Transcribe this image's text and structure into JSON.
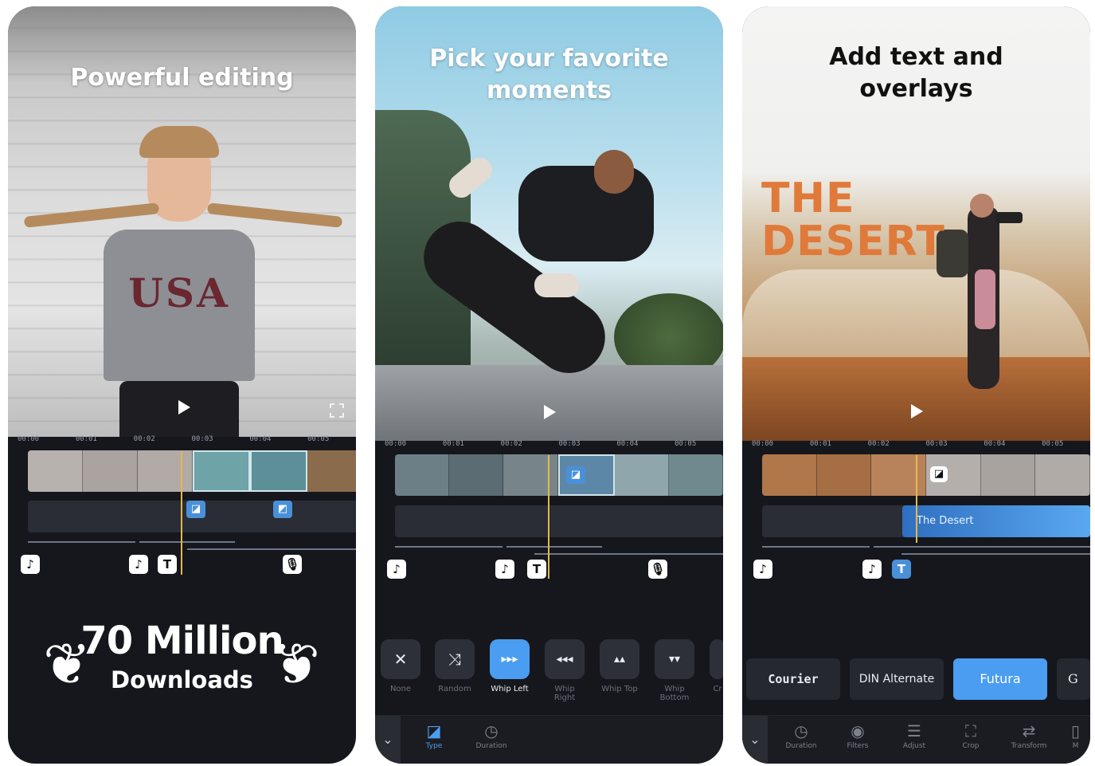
{
  "screens": [
    {
      "headline": "Powerful editing",
      "timecodes": [
        "00:00",
        "00:01",
        "00:02",
        "00:03",
        "00:04",
        "00:05"
      ],
      "badge_music": "♪",
      "badge_text": "T",
      "mic_icon": "mic-icon",
      "downloads_number": "70 Million",
      "downloads_label": "Downloads"
    },
    {
      "headline": "Pick your favorite moments",
      "timecodes": [
        "00:00",
        "00:01",
        "00:02",
        "00:03",
        "00:04",
        "00:05"
      ],
      "transitions": [
        {
          "label": "None",
          "icon": "✕",
          "active": false
        },
        {
          "label": "Random",
          "icon": "⤨",
          "active": false
        },
        {
          "label": "Whip Left",
          "icon": "▸▸▸",
          "active": true
        },
        {
          "label": "Whip Right",
          "icon": "◂◂◂",
          "active": false
        },
        {
          "label": "Whip Top",
          "icon": "▴▴",
          "active": false
        },
        {
          "label": "Whip Bottom",
          "icon": "▾▾",
          "active": false
        },
        {
          "label": "Cr",
          "icon": "",
          "active": false
        }
      ],
      "tools": [
        {
          "label": "Type",
          "active": true
        },
        {
          "label": "Duration",
          "active": false
        }
      ]
    },
    {
      "headline": "Add text and overlays",
      "overlay_title_line1": "THE",
      "overlay_title_line2": "DESERT",
      "text_clip": "The Desert",
      "timecodes": [
        "00:00",
        "00:01",
        "00:02",
        "00:03",
        "00:04",
        "00:05"
      ],
      "fonts": [
        {
          "label": "Courier",
          "active": false
        },
        {
          "label": "DIN Alternate",
          "active": false
        },
        {
          "label": "Futura",
          "active": true
        },
        {
          "label": "G",
          "active": false
        }
      ],
      "tools": [
        {
          "label": "Duration"
        },
        {
          "label": "Filters"
        },
        {
          "label": "Adjust"
        },
        {
          "label": "Crop"
        },
        {
          "label": "Transform"
        },
        {
          "label": "M"
        }
      ]
    }
  ],
  "colors": {
    "accent_blue": "#4a9df0",
    "playhead": "#e4b84a",
    "desert_orange": "#e07a3a"
  }
}
